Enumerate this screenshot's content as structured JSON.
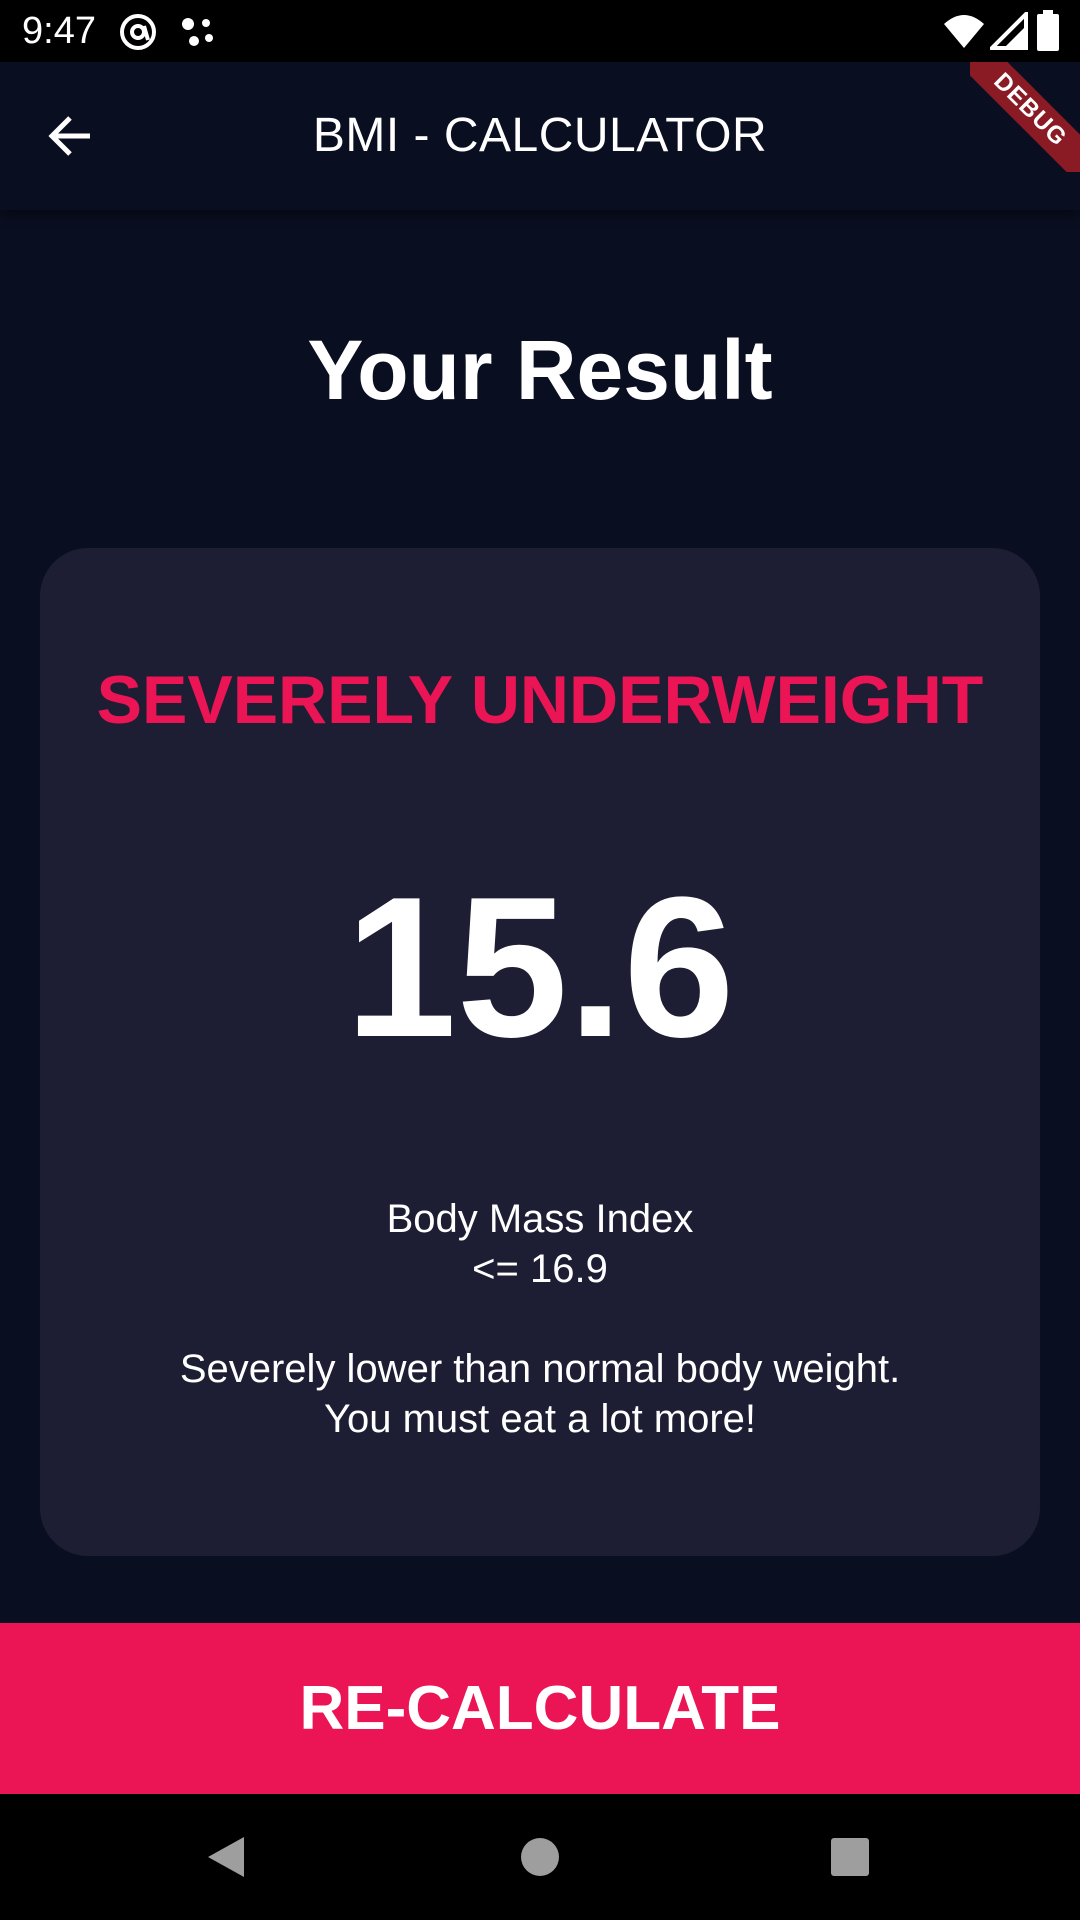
{
  "status_bar": {
    "time": "9:47",
    "icons": [
      "at-sign-icon",
      "assistant-dots-icon",
      "wifi-icon",
      "signal-icon",
      "battery-icon"
    ]
  },
  "app_bar": {
    "title": "BMI - CALCULATOR",
    "back_icon": "arrow-left-icon",
    "debug_banner": "DEBUG"
  },
  "main": {
    "heading": "Your Result",
    "card": {
      "category": "SEVERELY UNDERWEIGHT",
      "bmi_value": "15.6",
      "label": "Body Mass Index",
      "range": "<= 16.9",
      "advice_line1": "Severely lower than normal body weight.",
      "advice_line2": "You must eat a lot more!"
    }
  },
  "recalculate_button": {
    "label": "RE-CALCULATE"
  },
  "nav_bar": {
    "icons": [
      "back-triangle-icon",
      "home-circle-icon",
      "recents-square-icon"
    ]
  },
  "colors": {
    "background": "#0a0e21",
    "card": "#1d1e33",
    "accent": "#eb1555",
    "text": "#ffffff"
  }
}
